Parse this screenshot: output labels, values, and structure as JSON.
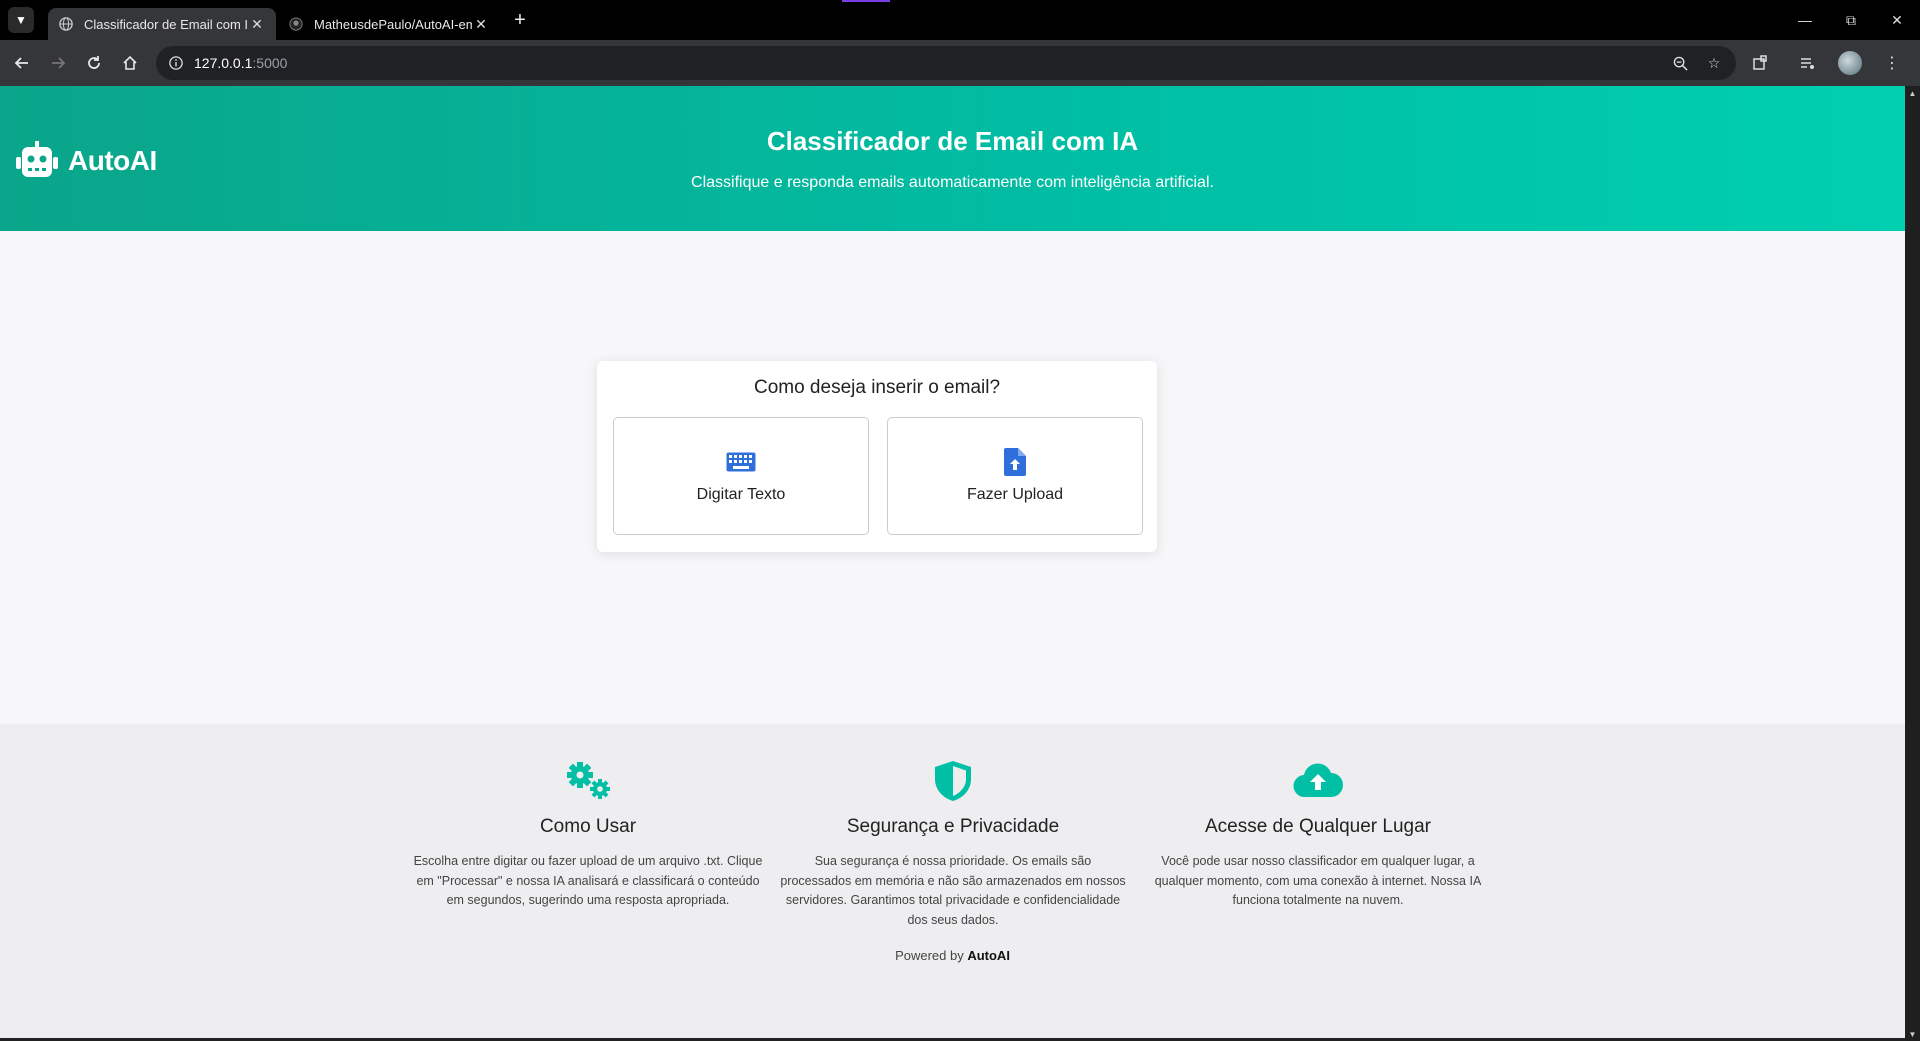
{
  "browser": {
    "tabs": [
      {
        "title": "Classificador de Email com IA",
        "active": true
      },
      {
        "title": "MatheusdePaulo/AutoAI-email",
        "active": false
      }
    ],
    "address": {
      "host": "127.0.0.1",
      "port": ":5000"
    }
  },
  "header": {
    "logo_text": "AutoAI",
    "title": "Classificador de Email com IA",
    "subtitle": "Classifique e responda emails automaticamente com inteligência artificial."
  },
  "input_card": {
    "title": "Como deseja inserir o email?",
    "options": [
      {
        "label": "Digitar Texto",
        "icon": "keyboard-icon"
      },
      {
        "label": "Fazer Upload",
        "icon": "file-upload-icon"
      }
    ]
  },
  "features": [
    {
      "icon": "gears-icon",
      "title": "Como Usar",
      "text": "Escolha entre digitar ou fazer upload de um arquivo .txt. Clique em \"Processar\" e nossa IA analisará e classificará o conteúdo em segundos, sugerindo uma resposta apropriada."
    },
    {
      "icon": "shield-icon",
      "title": "Segurança e Privacidade",
      "text": "Sua segurança é nossa prioridade. Os emails são processados em memória e não são armazenados em nossos servidores. Garantimos total privacidade e confidencialidade dos seus dados."
    },
    {
      "icon": "cloud-upload-icon",
      "title": "Acesse de Qualquer Lugar",
      "text": "Você pode usar nosso classificador em qualquer lugar, a qualquer momento, com uma conexão à internet. Nossa IA funciona totalmente na nuvem."
    }
  ],
  "footer": {
    "powered_prefix": "Powered by ",
    "powered_brand": "AutoAI"
  },
  "colors": {
    "accent": "#00bfa5",
    "icon_blue": "#2f6fdc"
  }
}
